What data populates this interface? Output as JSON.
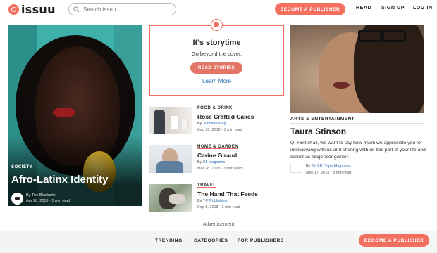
{
  "header": {
    "logo_text": "issuu",
    "search_placeholder": "Search issuu",
    "publisher_button": "BECOME A PUBLISHER",
    "nav": [
      "READ",
      "SIGN UP",
      "LOG IN"
    ]
  },
  "featured": {
    "category": "SOCIETY",
    "title": "Afro-Latinx Identity",
    "by": "By The Blackprint",
    "date": "Apr 28, 2018 · 5 min read"
  },
  "storytime": {
    "title": "It's storytime",
    "subtitle": "Go beyond the cover.",
    "button": "READ STORIES",
    "link": "Learn More"
  },
  "articles": [
    {
      "category": "FOOD & DRINK",
      "title": "Rose Crafted Cakes",
      "by_prefix": "By ",
      "publisher": "Junction Mag",
      "date": "Aug 30, 2018 · 3 min read"
    },
    {
      "category": "HOME & GARDEN",
      "title": "Carine Giraud",
      "by_prefix": "By ",
      "publisher": "91 Magazine",
      "date": "Mar 28, 2018 · 3 min read"
    },
    {
      "category": "TRAVEL",
      "title": "The Hand That Feeds",
      "by_prefix": "By ",
      "publisher": "T:P Publishing",
      "date": "Sep 5, 2018 · 3 min read"
    }
  ],
  "right_feature": {
    "category": "ARTS & ENTERTAINMENT",
    "title": "Taura Stinson",
    "body": "Q: First of all, we want to say how much we appreciate you for interviewing with us and sharing with us this part of your life and career as singer/songwriter.",
    "by_prefix": "By ",
    "publisher": "So FN Dope Magazine",
    "date": "May 17, 2018 · 8 min read"
  },
  "advertisement": "Advertisement",
  "footer": {
    "links": [
      "TRENDING",
      "CATEGORIES",
      "FOR PUBLISHERS"
    ],
    "publisher_button": "BECOME A PUBLISHER"
  },
  "colors": {
    "accent": "#f36f60",
    "link": "#2f6fb3"
  }
}
